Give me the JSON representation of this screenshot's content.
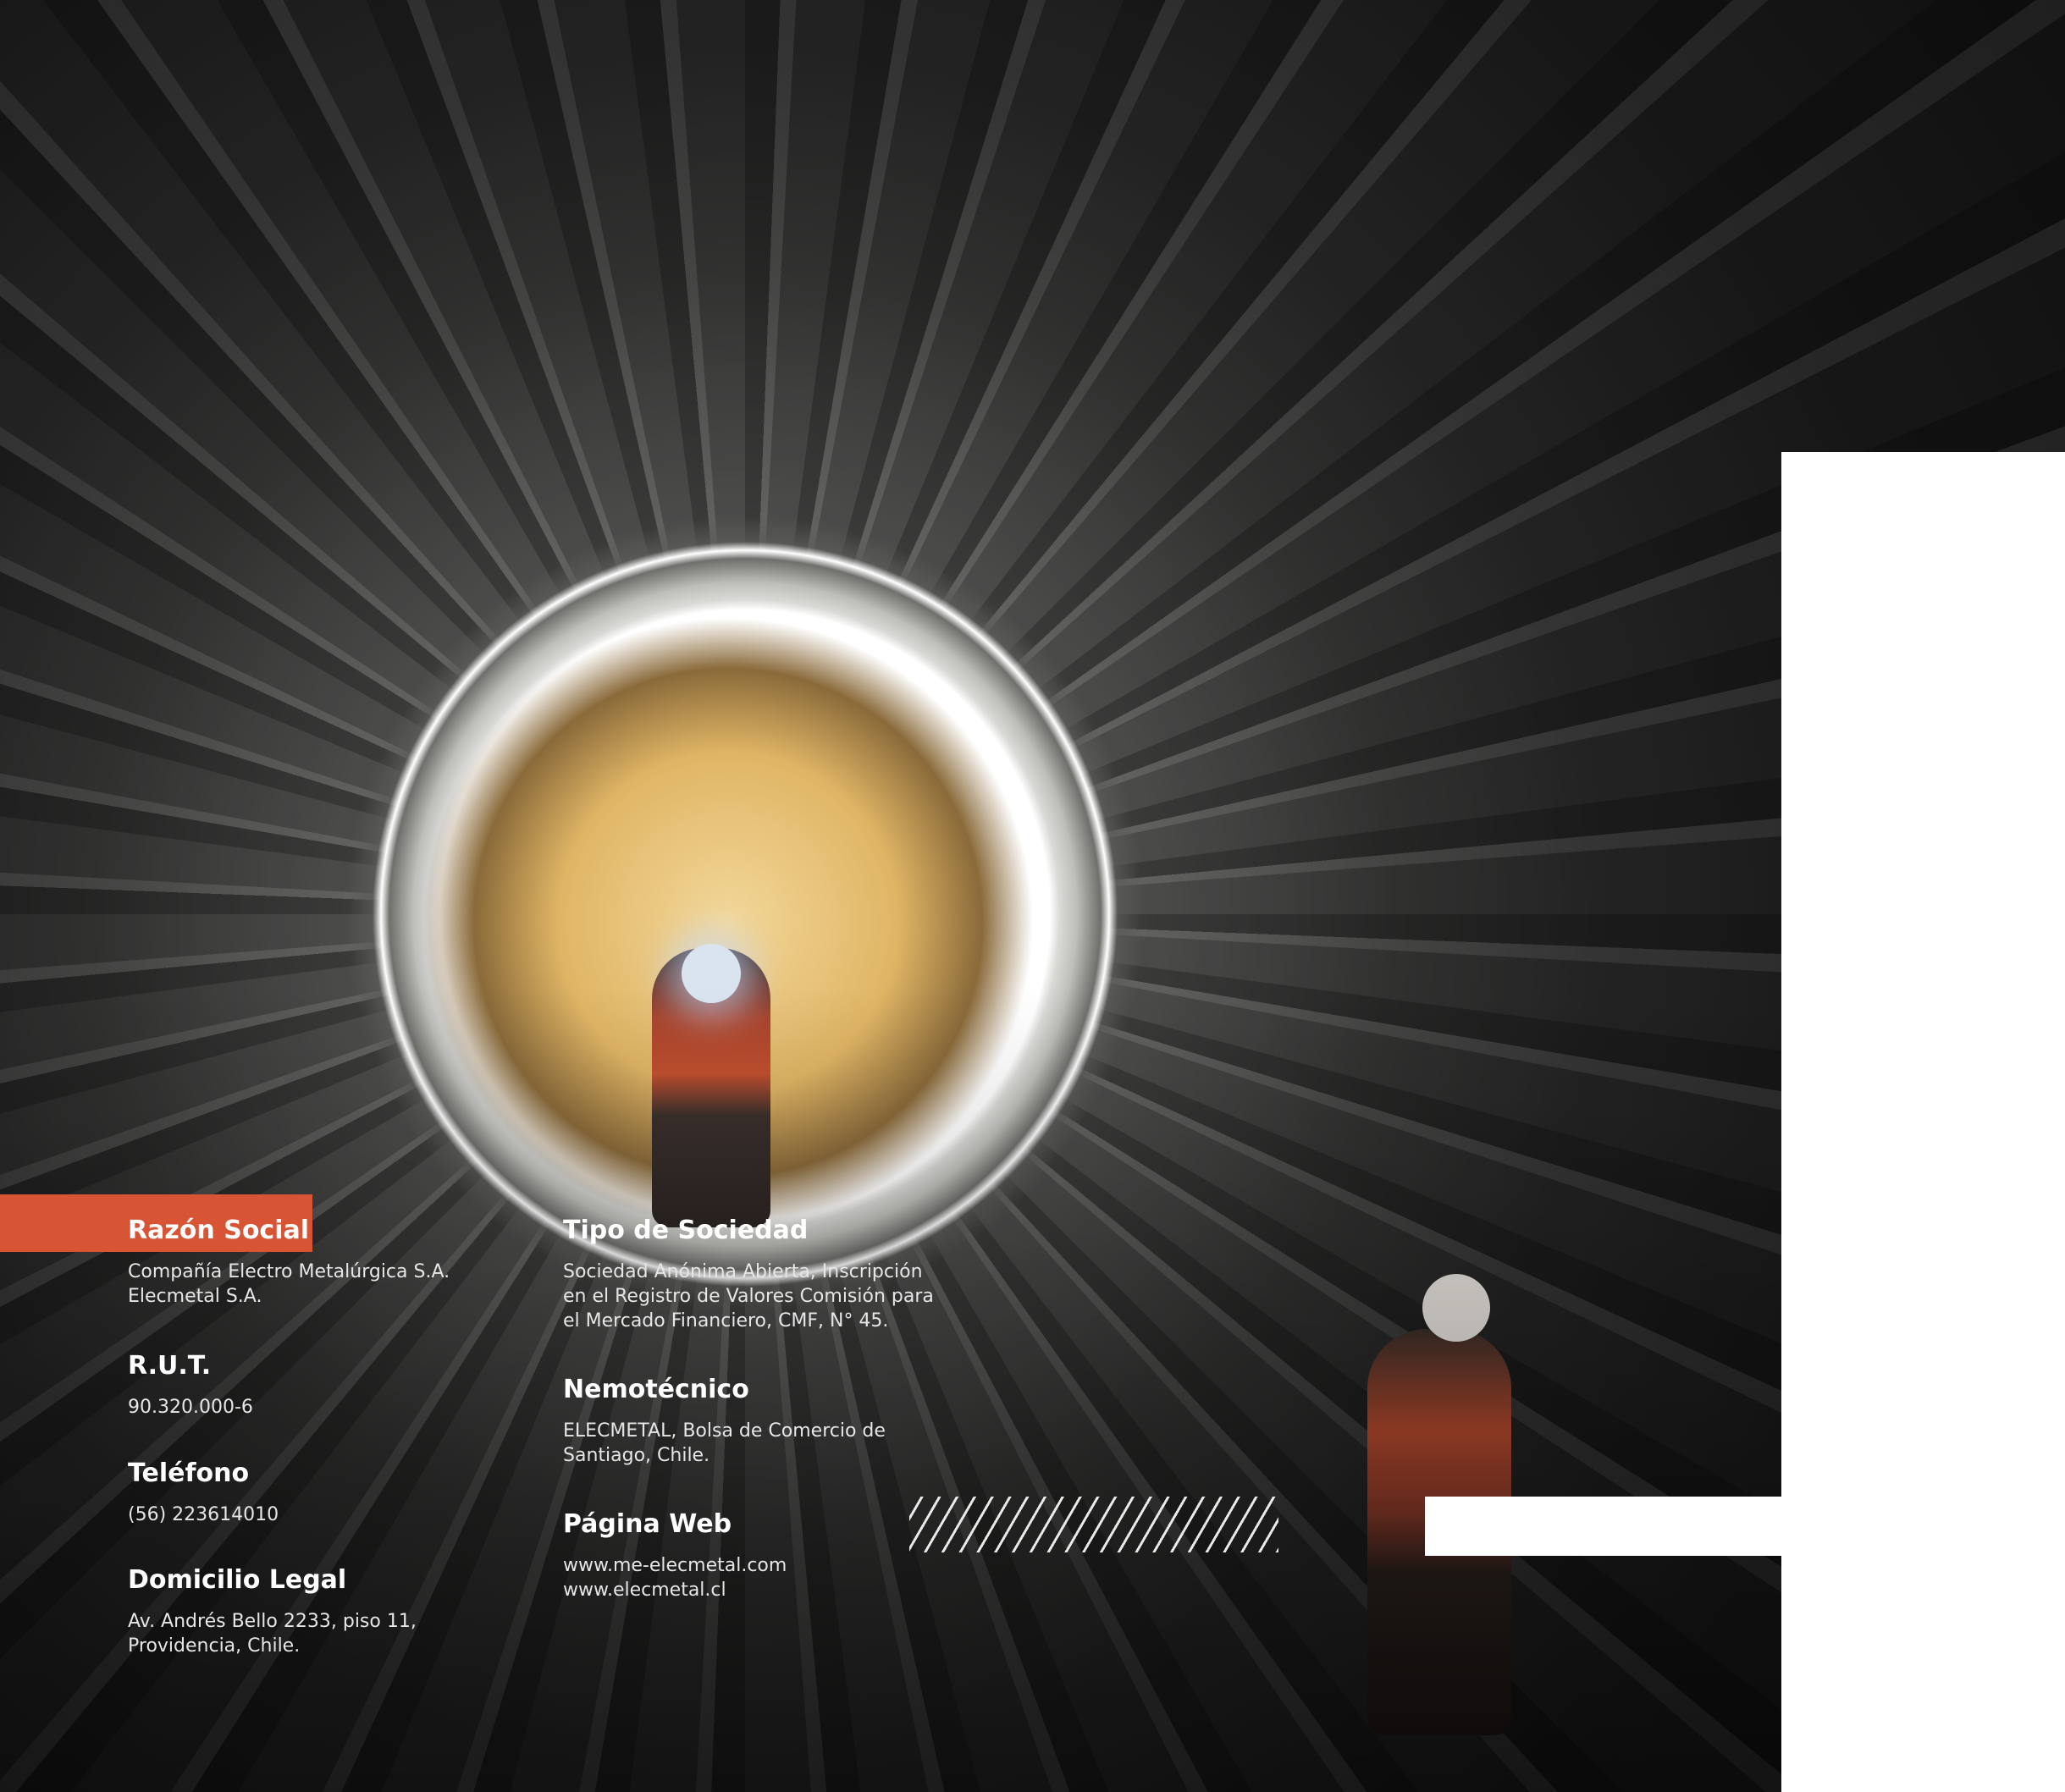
{
  "colors": {
    "accent": "#d75535",
    "text": "#ffffff",
    "panel": "#ffffff"
  },
  "info": {
    "razon_social": {
      "label": "Razón Social",
      "value": "Compañía Electro Metalúrgica S.A.\nElecmetal S.A."
    },
    "rut": {
      "label": "R.U.T.",
      "value": "90.320.000-6"
    },
    "telefono": {
      "label": "Teléfono",
      "value": "(56) 223614010"
    },
    "domicilio": {
      "label": "Domicilio Legal",
      "value": "Av. Andrés Bello 2233, piso 11,\nProvidencia, Chile."
    },
    "tipo_sociedad": {
      "label": "Tipo de Sociedad",
      "value": "Sociedad Anónima Abierta, Inscripción\nen el Registro de Valores Comisión para\nel Mercado Financiero, CMF, N° 45."
    },
    "nemotecnico": {
      "label": "Nemotécnico",
      "value": "ELECMETAL, Bolsa de Comercio de\nSantiago, Chile."
    },
    "pagina_web": {
      "label": "Página Web",
      "value": "www.me-elecmetal.com\nwww.elecmetal.cl"
    }
  }
}
